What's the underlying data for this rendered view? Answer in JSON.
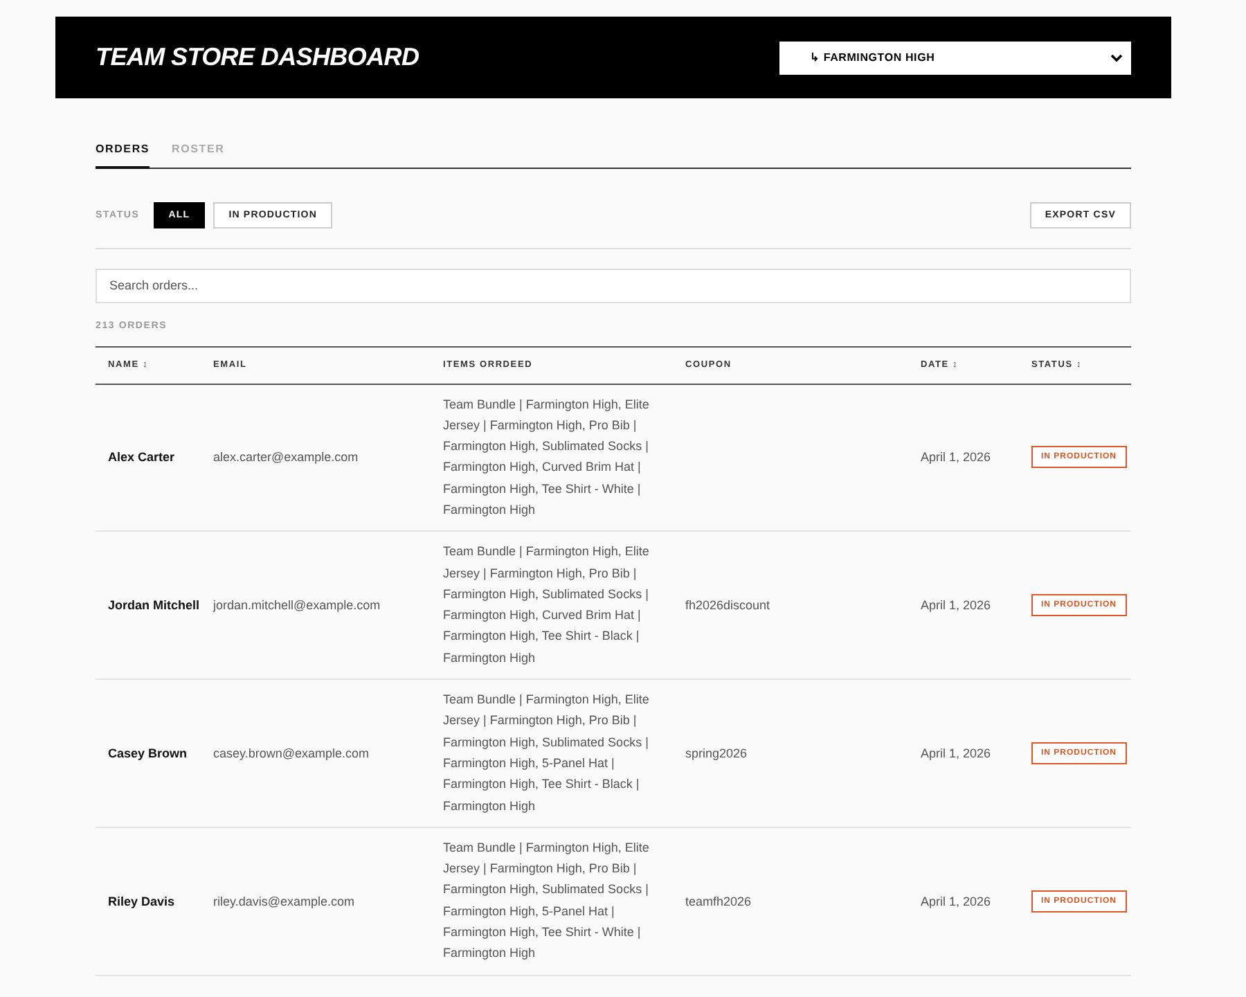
{
  "header": {
    "title": "TEAM STORE DASHBOARD",
    "school_select": {
      "value": "↳ FARMINGTON HIGH"
    }
  },
  "tabs": [
    {
      "label": "ORDERS",
      "selected": true
    },
    {
      "label": "ROSTER",
      "selected": false
    }
  ],
  "filters": {
    "label": "STATUS",
    "options": [
      {
        "label": "ALL",
        "selected": true
      },
      {
        "label": "IN PRODUCTION",
        "selected": false
      }
    ]
  },
  "export_button": "EXPORT CSV",
  "search": {
    "placeholder": "Search orders..."
  },
  "order_count": "213 ORDERS",
  "table": {
    "columns": [
      "NAME ↕",
      "EMAIL",
      "ITEMS ORRDEED",
      "COUPON",
      "DATE ↕",
      "STATUS ↕"
    ],
    "rows": [
      {
        "name": "Alex Carter",
        "email": "alex.carter@example.com",
        "items": "Team Bundle | Farmington High, Elite Jersey | Farmington High, Pro Bib | Farmington High, Sublimated Socks | Farmington High, Curved Brim Hat | Farmington High, Tee Shirt - White | Farmington High",
        "coupon": "",
        "date": "April 1, 2026",
        "status": "IN PRODUCTION"
      },
      {
        "name": "Jordan Mitchell",
        "email": "jordan.mitchell@example.com",
        "items": "Team Bundle | Farmington High, Elite Jersey | Farmington High, Pro Bib | Farmington High, Sublimated Socks | Farmington High, Curved Brim Hat | Farmington High, Tee Shirt - Black | Farmington High",
        "coupon": "fh2026discount",
        "date": "April 1, 2026",
        "status": "IN PRODUCTION"
      },
      {
        "name": "Casey Brown",
        "email": "casey.brown@example.com",
        "items": "Team Bundle | Farmington High, Elite Jersey | Farmington High, Pro Bib | Farmington High, Sublimated Socks | Farmington High, 5-Panel Hat | Farmington High, Tee Shirt - Black | Farmington High",
        "coupon": "spring2026",
        "date": "April 1, 2026",
        "status": "IN PRODUCTION"
      },
      {
        "name": "Riley Davis",
        "email": "riley.davis@example.com",
        "items": "Team Bundle | Farmington High, Elite Jersey | Farmington High, Pro Bib | Farmington High, Sublimated Socks | Farmington High, 5-Panel Hat | Farmington High, Tee Shirt - White | Farmington High",
        "coupon": "teamfh2026",
        "date": "April 1, 2026",
        "status": "IN PRODUCTION"
      }
    ]
  }
}
